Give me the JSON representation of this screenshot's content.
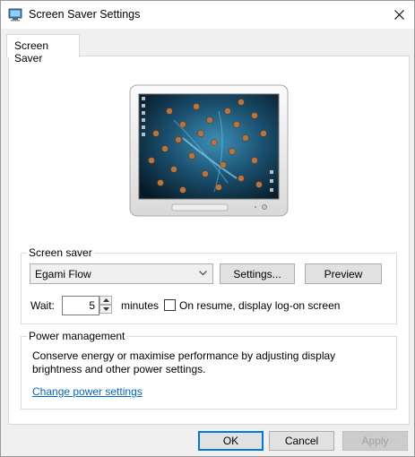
{
  "window": {
    "title": "Screen Saver Settings",
    "icon": "screen-saver-settings-icon",
    "close_icon": "close-icon"
  },
  "tabs": [
    {
      "label": "Screen Saver",
      "selected": true
    }
  ],
  "screen_saver": {
    "group_label": "Screen saver",
    "selected": "Egami Flow",
    "settings_label": "Settings...",
    "preview_label": "Preview",
    "wait_label": "Wait:",
    "wait_value": "5",
    "minutes_label": "minutes",
    "resume_label": "On resume, display log-on screen",
    "resume_checked": false
  },
  "power": {
    "group_label": "Power management",
    "description_line1": "Conserve energy or maximise performance by adjusting display",
    "description_line2": "brightness and other power settings.",
    "link_label": "Change power settings"
  },
  "footer": {
    "ok_label": "OK",
    "cancel_label": "Cancel",
    "apply_label": "Apply",
    "apply_disabled": true
  },
  "colors": {
    "accent": "#0078d7",
    "link": "#0066cc",
    "screen_bg": "#0e2a3a"
  }
}
